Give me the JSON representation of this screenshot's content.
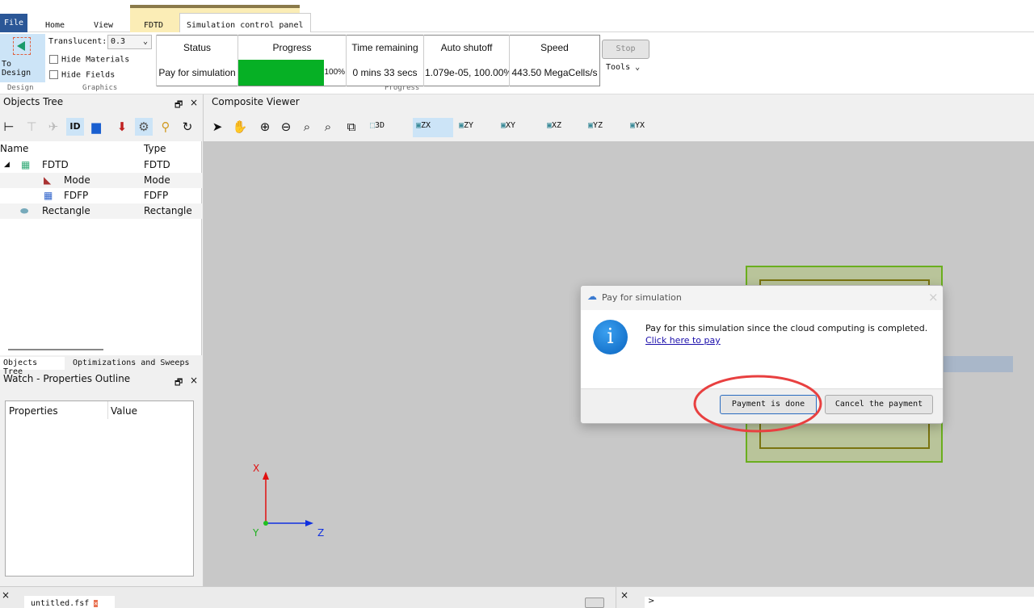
{
  "ribbon_tabs": [
    {
      "label": "File"
    },
    {
      "label": "Home"
    },
    {
      "label": "View"
    },
    {
      "label": "FDTD"
    },
    {
      "label": "Simulation control panel"
    }
  ],
  "design": {
    "to_design": "To Design",
    "group": "Design"
  },
  "graphics": {
    "translucent_label": "Translucent:",
    "translucent_value": "0.3",
    "hide_materials": "Hide Materials",
    "hide_fields": "Hide Fields",
    "group": "Graphics"
  },
  "progress": {
    "headers": [
      "Status",
      "Progress",
      "Time remaining",
      "Auto shutoff",
      "Speed"
    ],
    "status": "Pay for simulation",
    "percent": 100,
    "percent_label": "100%",
    "time_remaining": "0 mins 33 secs",
    "auto_shutoff": "1.079e-05, 100.00%",
    "speed": "443.50 MegaCells/s",
    "group": "Progress",
    "stop": "Stop",
    "tools": "Tools"
  },
  "objects_tree": {
    "title": "Objects Tree",
    "col_name": "Name",
    "col_type": "Type",
    "rows": [
      {
        "name": "FDTD",
        "type": "FDTD"
      },
      {
        "name": "Mode",
        "type": "Mode"
      },
      {
        "name": "FDFP",
        "type": "FDFP"
      },
      {
        "name": "Rectangle",
        "type": "Rectangle"
      }
    ]
  },
  "left_tabs": [
    "Objects Tree",
    "Optimizations and Sweeps"
  ],
  "watch": {
    "title": "Watch - Properties Outline",
    "col_props": "Properties",
    "col_value": "Value"
  },
  "viewer": {
    "title": "Composite Viewer",
    "views": [
      "3D",
      "ZX",
      "ZY",
      "XY",
      "XZ",
      "YZ",
      "YX"
    ],
    "axis_x": "X",
    "axis_y": "Y",
    "axis_z": "Z"
  },
  "dialog": {
    "title": "Pay for simulation",
    "message": "Pay for this simulation since the cloud computing is completed.",
    "link": "Click here to pay",
    "ok": "Payment is done",
    "cancel": "Cancel the payment"
  },
  "bottom": {
    "file_tab": "untitled.fsf",
    "close": "×",
    "prompt": ">"
  }
}
